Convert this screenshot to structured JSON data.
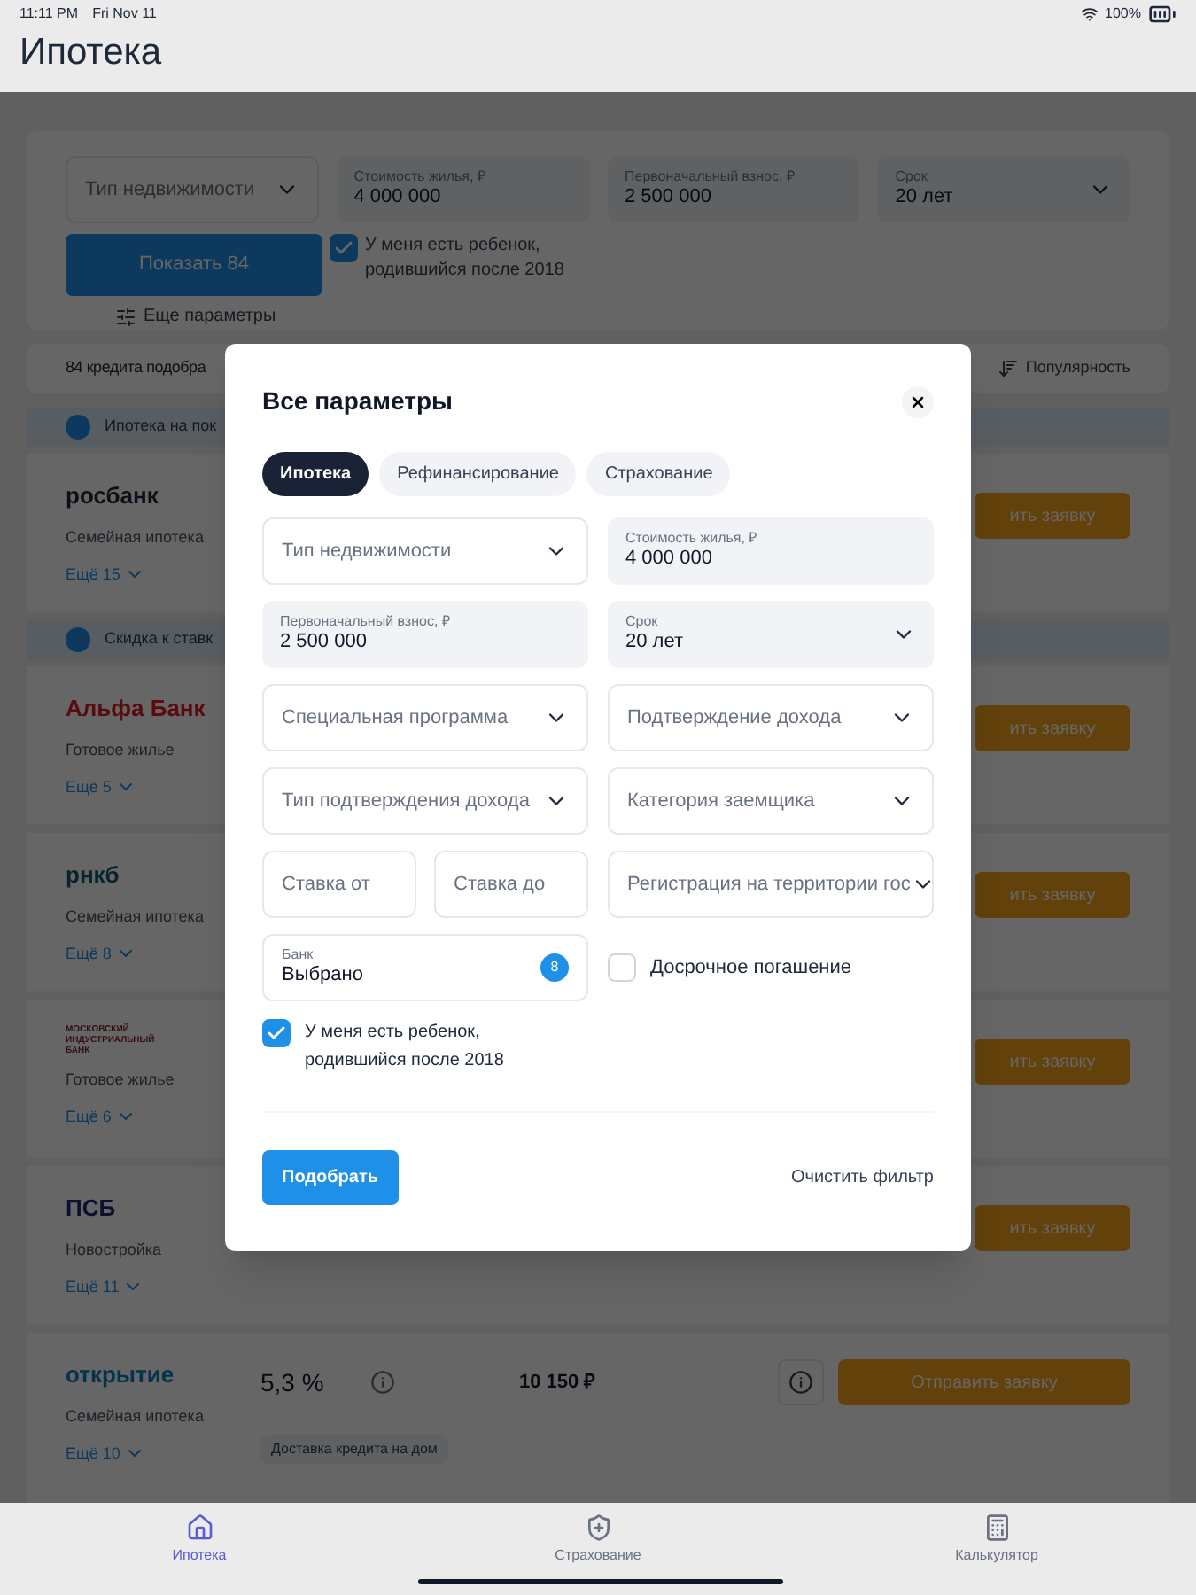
{
  "status_bar": {
    "time": "11:11 PM",
    "date": "Fri Nov 11",
    "battery": "100%"
  },
  "header": {
    "title": "Ипотека"
  },
  "filters": {
    "items": [
      {
        "kind": "select",
        "placeholder": "Тип недвижимости"
      },
      {
        "kind": "value",
        "label": "Стоимость жилья, ₽",
        "value": "4 000 000"
      },
      {
        "kind": "value",
        "label": "Первоначальный взнос, ₽",
        "value": "2 500 000"
      },
      {
        "kind": "value_select",
        "label": "Срок",
        "value": "20 лет"
      }
    ],
    "show_button": "Показать 84",
    "child_checkbox": {
      "label": "У меня есть ребенок, родившийся после 2018",
      "checked": true
    },
    "more": "Еще параметры"
  },
  "results": {
    "count": "84 кредита подобра",
    "sort": "Популярность"
  },
  "offers": [
    {
      "kind": "heading",
      "text": "Ипотека на пок"
    },
    {
      "kind": "partial",
      "logo": "росбанк",
      "product": "Семейная ипотека",
      "more": "Ещё 15",
      "button": "ить заявку"
    },
    {
      "kind": "heading",
      "text": "Скидка к ставк"
    },
    {
      "kind": "partial",
      "logo": "Альфа Банк",
      "product": "Готовое жилье",
      "more": "Ещё 5",
      "button": "ить заявку"
    },
    {
      "kind": "partial",
      "logo": "рнкб",
      "product": "Семейная ипотека",
      "more": "Ещё 8",
      "button": "ить заявку"
    },
    {
      "kind": "partial",
      "logo": "МОСКОВСКИЙ ИНДУСТРИАЛЬНЫЙ БАНК",
      "product": "Готовое жилье",
      "more": "Ещё 6",
      "button": "ить заявку"
    },
    {
      "kind": "partial",
      "logo": "ПСБ",
      "product": "Новостройка",
      "more": "Ещё 11",
      "button": "ить заявку"
    },
    {
      "kind": "full",
      "logo": "открытие",
      "product": "Семейная ипотека",
      "more": "Ещё 10",
      "rate": "5,3 %",
      "payment": "10 150 ₽",
      "button": "Отправить заявку",
      "tag": "Доставка кредита на дом"
    }
  ],
  "modal": {
    "title": "Все параметры",
    "tabs": [
      {
        "label": "Ипотека",
        "selected": true
      },
      {
        "label": "Рефинансирование",
        "selected": false
      },
      {
        "label": "Страхование",
        "selected": false
      }
    ],
    "fields": [
      {
        "kind": "select",
        "placeholder": "Тип недвижимости"
      },
      {
        "kind": "value",
        "label": "Стоимость жилья, ₽",
        "value": "4 000 000"
      },
      {
        "kind": "value",
        "label": "Первоначальный взнос, ₽",
        "value": "2 500 000"
      },
      {
        "kind": "value_select",
        "label": "Срок",
        "value": "20 лет"
      },
      {
        "kind": "select",
        "placeholder": "Специальная программа"
      },
      {
        "kind": "select",
        "placeholder": "Подтверждение дохода"
      },
      {
        "kind": "select",
        "placeholder": "Тип подтверждения дохода"
      },
      {
        "kind": "select",
        "placeholder": "Категория заемщика"
      },
      {
        "kind": "pair",
        "placeholders": [
          "Ставка от",
          "Ставка до"
        ]
      },
      {
        "kind": "select",
        "placeholder": "Регистрация на территории гос"
      },
      {
        "kind": "bank",
        "label": "Банк",
        "value": "Выбрано",
        "count": "8"
      },
      {
        "kind": "checkbox",
        "label": "Досрочное погашение",
        "checked": false
      }
    ],
    "child_checkbox": {
      "label": "У меня есть ребенок, родившийся после 2018",
      "checked": true
    },
    "submit": "Подобрать",
    "clear": "Очистить фильтр"
  },
  "tab_bar": [
    {
      "label": "Ипотека",
      "selected": true
    },
    {
      "label": "Страхование",
      "selected": false
    },
    {
      "label": "Калькулятор",
      "selected": false
    }
  ]
}
